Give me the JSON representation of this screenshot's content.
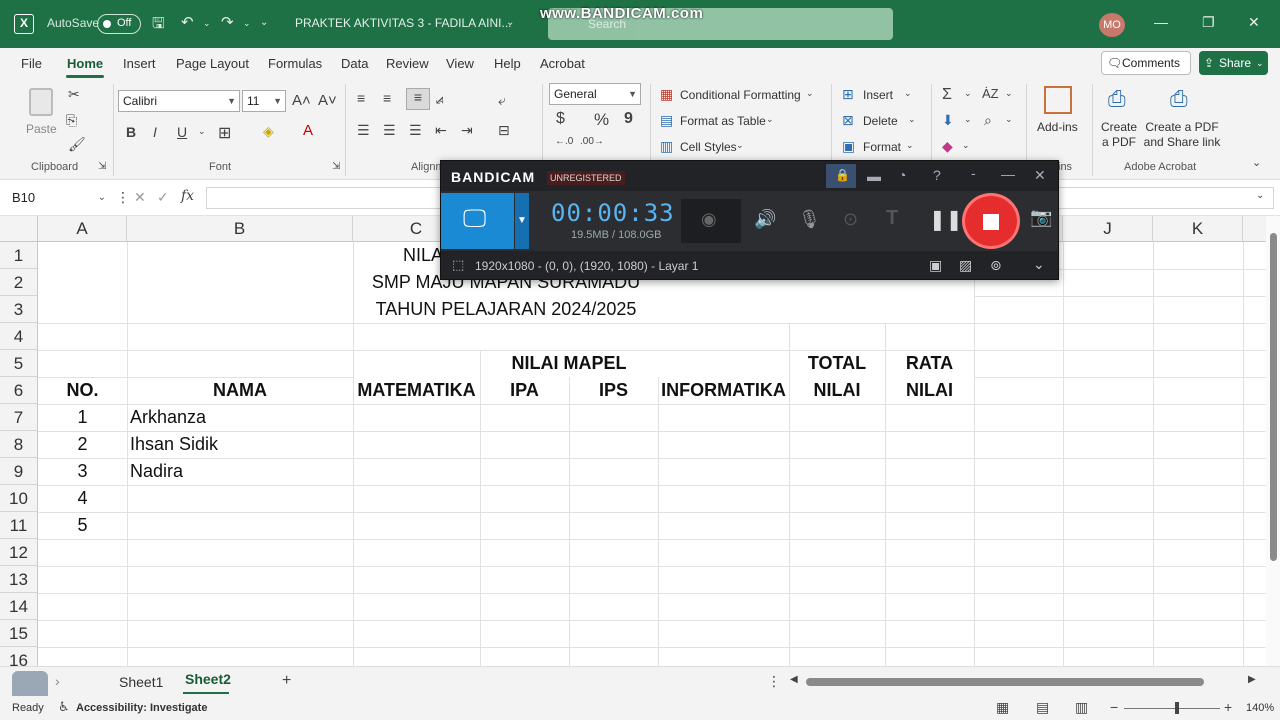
{
  "titlebar": {
    "app_icon": "X",
    "autosave_label": "AutoSave",
    "autosave_state": "Off",
    "doc_title": "PRAKTEK AKTIVITAS 3 - FADILA AINI...",
    "search_placeholder": "Search",
    "watermark": "www.BANDICAM.com",
    "avatar": "MO"
  },
  "menu": {
    "tabs": [
      "File",
      "Home",
      "Insert",
      "Page Layout",
      "Formulas",
      "Data",
      "Review",
      "View",
      "Help",
      "Acrobat"
    ],
    "active": "Home",
    "comments_label": "Comments",
    "share_label": "Share"
  },
  "ribbon": {
    "clipboard": {
      "paste_label": "Paste",
      "group_label": "Clipboard"
    },
    "font": {
      "font_name": "Calibri",
      "font_size": "11",
      "group_label": "Font",
      "bold": "B",
      "italic": "I",
      "underline": "U"
    },
    "alignment": {
      "group_label": "Alignm"
    },
    "number": {
      "format": "General",
      "currency": "$",
      "percent": "%",
      "comma": "9"
    },
    "styles": {
      "conditional": "Conditional Formatting",
      "format_table": "Format as Table",
      "cell_styles": "Cell Styles"
    },
    "cells": {
      "insert": "Insert",
      "delete": "Delete",
      "format": "Format"
    },
    "addins": {
      "label": "Add-ins",
      "group_label": "ins"
    },
    "acrobat": {
      "create_pdf": "Create a PDF",
      "create_share": "Create a PDF and Share link",
      "group_label": "Adobe Acrobat"
    }
  },
  "formula_bar": {
    "name_box": "B10",
    "fx": "fx"
  },
  "grid": {
    "columns": [
      "A",
      "B",
      "C",
      "",
      "",
      "",
      "",
      "",
      "",
      "J",
      "K"
    ],
    "rows": [
      "1",
      "2",
      "3",
      "4",
      "5",
      "6",
      "7",
      "8",
      "9",
      "10",
      "11",
      "12",
      "13",
      "14",
      "15",
      "16"
    ],
    "title1": "NILA",
    "title2": "SMP MAJU MAPAN SURAMADU",
    "title3": "TAHUN PELAJARAN 2024/2025",
    "hdr_nilai_mapel": "NILAI MAPEL",
    "hdr_total": "TOTAL",
    "hdr_rata": "RATA",
    "hdr_no": "NO.",
    "hdr_nama": "NAMA",
    "hdr_mtk": "MATEMATIKA",
    "hdr_ipa": "IPA",
    "hdr_ips": "IPS",
    "hdr_inf": "INFORMATIKA",
    "hdr_nilai1": "NILAI",
    "hdr_nilai2": "NILAI",
    "students": [
      {
        "no": "1",
        "nama": "Arkhanza"
      },
      {
        "no": "2",
        "nama": "Ihsan Sidik"
      },
      {
        "no": "3",
        "nama": "Nadira"
      },
      {
        "no": "4",
        "nama": ""
      },
      {
        "no": "5",
        "nama": ""
      }
    ]
  },
  "sheets": {
    "tab1": "Sheet1",
    "tab2": "Sheet2",
    "active": "Sheet2"
  },
  "status": {
    "ready": "Ready",
    "accessibility": "Accessibility: Investigate",
    "zoom": "140%"
  },
  "bandicam": {
    "brand": "BANDICAM",
    "unregistered": "UNREGISTERED",
    "timer": "00:00:33",
    "size": "19.5MB / 108.0GB",
    "region": "1920x1080 - (0, 0), (1920, 1080) - Layar 1"
  }
}
